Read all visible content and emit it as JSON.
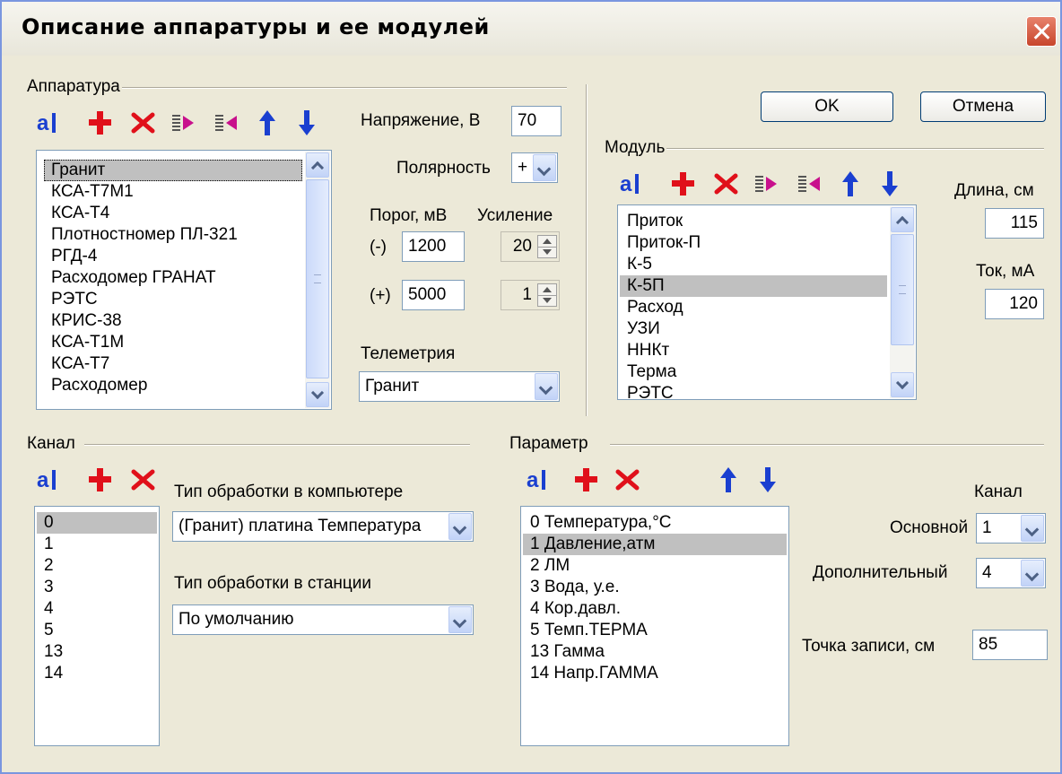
{
  "window": {
    "title": "Описание аппаратуры и ее модулей"
  },
  "buttons": {
    "ok": "OK",
    "cancel": "Отмена"
  },
  "apparatus": {
    "group_label": "Аппаратура",
    "items": [
      "Гранит",
      "КСА-Т7М1",
      "КСА-Т4",
      "Плотностномер ПЛ-321",
      "РГД-4",
      "Расходомер ГРАНАТ",
      "РЭТС",
      "КРИС-38",
      "КСА-Т1М",
      "КСА-Т7",
      "Расходомер"
    ],
    "selected_index": 0,
    "voltage_label": "Напряжение, В",
    "voltage_value": "70",
    "polarity_label": "Полярность",
    "polarity_value": "+",
    "threshold_label": "Порог, мВ",
    "gain_label": "Усиление",
    "minus_label": "(-)",
    "plus_label": "(+)",
    "threshold_minus": "1200",
    "threshold_plus": "5000",
    "gain_minus": "20",
    "gain_plus": "1",
    "telemetry_label": "Телеметрия",
    "telemetry_value": "Гранит"
  },
  "module": {
    "group_label": "Модуль",
    "items": [
      "Приток",
      "Приток-П",
      "К-5",
      "К-5П",
      "Расход",
      "УЗИ",
      "ННКт",
      "Терма",
      "РЭТС"
    ],
    "selected_index": 3,
    "length_label": "Длина, см",
    "length_value": "115",
    "current_label": "Ток, мА",
    "current_value": "120"
  },
  "channel": {
    "group_label": "Канал",
    "items": [
      "0",
      "1",
      "2",
      "3",
      "4",
      "5",
      "13",
      "14"
    ],
    "selected_index": 0,
    "pc_processing_label": "Тип обработки в компьютере",
    "pc_processing_value": "(Гранит) платина Температура",
    "station_processing_label": "Тип обработки в станции",
    "station_processing_value": "По умолчанию"
  },
  "parameter": {
    "group_label": "Параметр",
    "items": [
      "0 Температура,°С",
      "1 Давление,атм",
      "2 ЛМ",
      "3 Вода, у.е.",
      "4 Кор.давл.",
      "5 Темп.ТЕРМА",
      "13 Гамма",
      "14 Напр.ГАММА"
    ],
    "selected_index": 1,
    "channel_label": "Канал",
    "main_label": "Основной",
    "main_value": "1",
    "extra_label": "Дополнительный",
    "extra_value": "4",
    "record_point_label": "Точка записи, см",
    "record_point_value": "85"
  },
  "colors": {
    "icon_blue": "#1a3fd0",
    "icon_red": "#e0101a",
    "icon_magenta": "#c8108c",
    "selection": "#c0c0c0"
  },
  "icons": [
    "rename-icon",
    "add-icon",
    "delete-icon",
    "import-icon",
    "export-icon",
    "move-up-icon",
    "move-down-icon"
  ]
}
